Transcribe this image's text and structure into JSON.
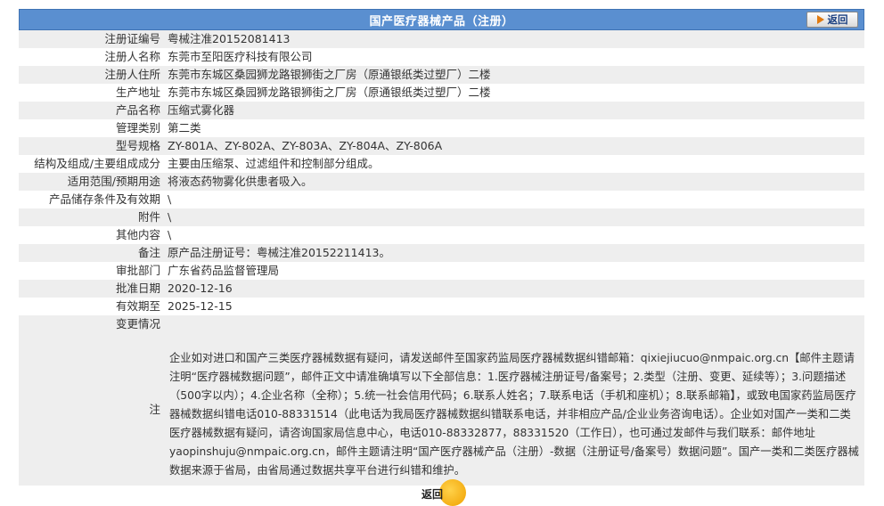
{
  "header": {
    "title": "国产医疗器械产品（注册）",
    "back_label": "返回"
  },
  "rows": [
    {
      "label": "注册证编号",
      "value": "粤械注准20152081413"
    },
    {
      "label": "注册人名称",
      "value": "东莞市至阳医疗科技有限公司"
    },
    {
      "label": "注册人住所",
      "value": "东莞市东城区桑园狮龙路银狮街之厂房（原通银纸类过塑厂）二楼"
    },
    {
      "label": "生产地址",
      "value": "东莞市东城区桑园狮龙路银狮街之厂房（原通银纸类过塑厂）二楼"
    },
    {
      "label": "产品名称",
      "value": "压缩式雾化器"
    },
    {
      "label": "管理类别",
      "value": "第二类"
    },
    {
      "label": "型号规格",
      "value": "ZY-801A、ZY-802A、ZY-803A、ZY-804A、ZY-806A"
    },
    {
      "label": "结构及组成/主要组成成分",
      "value": "主要由压缩泵、过滤组件和控制部分组成。"
    },
    {
      "label": "适用范围/预期用途",
      "value": "将液态药物雾化供患者吸入。"
    },
    {
      "label": "产品储存条件及有效期",
      "value": "\\"
    },
    {
      "label": "附件",
      "value": "\\"
    },
    {
      "label": "其他内容",
      "value": "\\"
    },
    {
      "label": "备注",
      "value": "原产品注册证号：粤械注准20152211413。"
    },
    {
      "label": "审批部门",
      "value": "广东省药品监督管理局"
    },
    {
      "label": "批准日期",
      "value": "2020-12-16"
    },
    {
      "label": "有效期至",
      "value": "2025-12-15"
    },
    {
      "label": "变更情况",
      "value": ""
    }
  ],
  "note": {
    "label": "注",
    "text": "企业如对进口和国产三类医疗器械数据有疑问，请发送邮件至国家药监局医疗器械数据纠错邮箱：qixiejiucuo@nmpaic.org.cn【邮件主题请注明“医疗器械数据问题”，邮件正文中请准确填写以下全部信息：1.医疗器械注册证号/备案号；2.类型（注册、变更、延续等）；3.问题描述（500字以内）；4.企业名称（全称）；5.统一社会信用代码；6.联系人姓名；7.联系电话（手机和座机）；8.联系邮箱】，或致电国家药监局医疗器械数据纠错电话010-88331514（此电话为我局医疗器械数据纠错联系电话，并非相应产品/企业业务咨询电话）。企业如对国产一类和二类医疗器械数据有疑问，请咨询国家局信息中心，电话010-88332877，88331520（工作日），也可通过发邮件与我们联系：邮件地址yaopinshuju@nmpaic.org.cn，邮件主题请注明“国产医疗器械产品（注册）-数据（注册证号/备案号）数据问题”。国产一类和二类医疗器械数据来源于省局，由省局通过数据共享平台进行纠错和维护。"
  },
  "footer": {
    "back_label": "返回"
  }
}
